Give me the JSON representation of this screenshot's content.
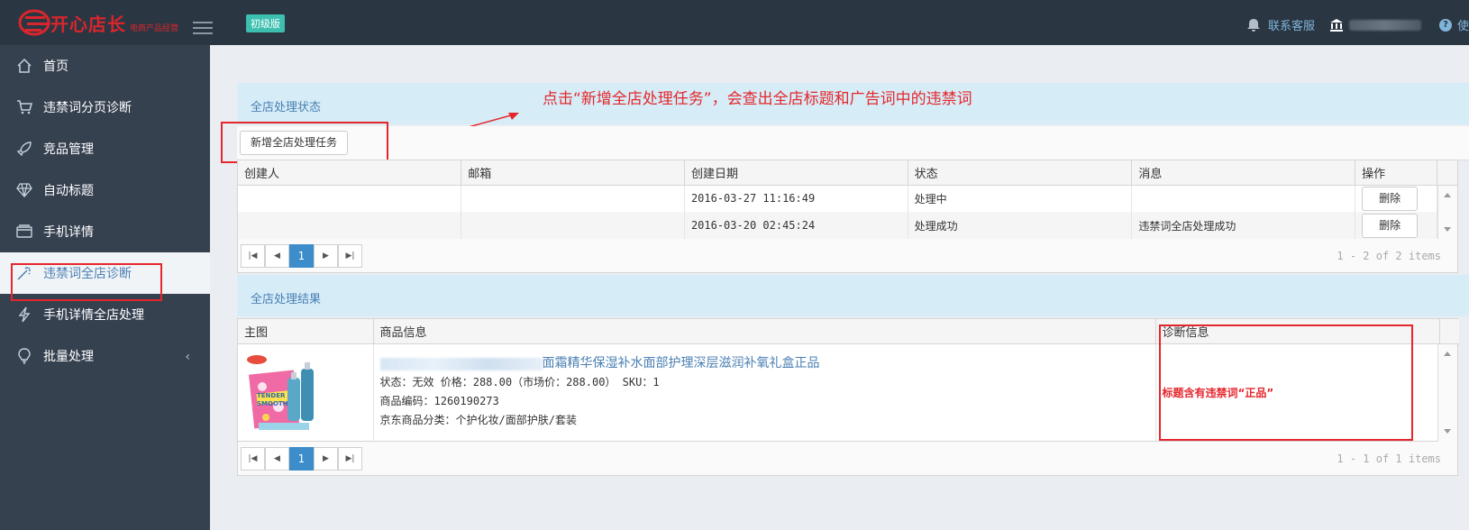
{
  "header": {
    "logo_text": "开心店长",
    "logo_sub": "电商产品经营",
    "version_badge": "初级版",
    "support_label": "联系客服",
    "help_label": "使"
  },
  "sidebar": {
    "items": [
      {
        "label": "首页",
        "icon": "home-icon"
      },
      {
        "label": "违禁词分页诊断",
        "icon": "cart-icon"
      },
      {
        "label": "竞品管理",
        "icon": "rocket-icon"
      },
      {
        "label": "自动标题",
        "icon": "diamond-icon"
      },
      {
        "label": "手机详情",
        "icon": "wallet-icon"
      },
      {
        "label": "违禁词全店诊断",
        "icon": "magic-wand-icon",
        "active": true
      },
      {
        "label": "手机详情全店处理",
        "icon": "bolt-icon"
      },
      {
        "label": "批量处理",
        "icon": "bulb-icon"
      }
    ]
  },
  "status_panel": {
    "title": "全店处理状态",
    "new_task_button": "新增全店处理任务",
    "annotation": "点击“新增全店处理任务”，会查出全店标题和广告词中的违禁词",
    "columns": [
      "创建人",
      "邮箱",
      "创建日期",
      "状态",
      "消息",
      "操作"
    ],
    "rows": [
      {
        "creator": "",
        "email": "",
        "date": "2016-03-27 11:16:49",
        "status": "处理中",
        "message": "",
        "action": "删除"
      },
      {
        "creator": "",
        "email": "",
        "date": "2016-03-20 02:45:24",
        "status": "处理成功",
        "message": "违禁词全店处理成功",
        "action": "删除"
      }
    ],
    "pager": {
      "current": "1",
      "info": "1 - 2 of 2 items"
    }
  },
  "result_panel": {
    "title": "全店处理结果",
    "columns": [
      "主图",
      "商品信息",
      "诊断信息"
    ],
    "product": {
      "title": "面霜精华保湿补水面部护理深层滋润补氧礼盒正品",
      "status_line": "状态：无效 价格：288.00（市场价：288.00） SKU：1",
      "code_line": "商品编码：1260190273",
      "category_line": "京东商品分类：个护化妆/面部护肤/套装",
      "diagnosis": "标题含有违禁词“正品”",
      "image_label": "TENDER SMOOTH"
    },
    "pager": {
      "current": "1",
      "info": "1 - 1 of 1 items"
    }
  },
  "colors": {
    "topbar": "#2b3643",
    "sidebar": "#364150",
    "accent": "#3c8dca",
    "annotation_red": "#e5262c"
  }
}
